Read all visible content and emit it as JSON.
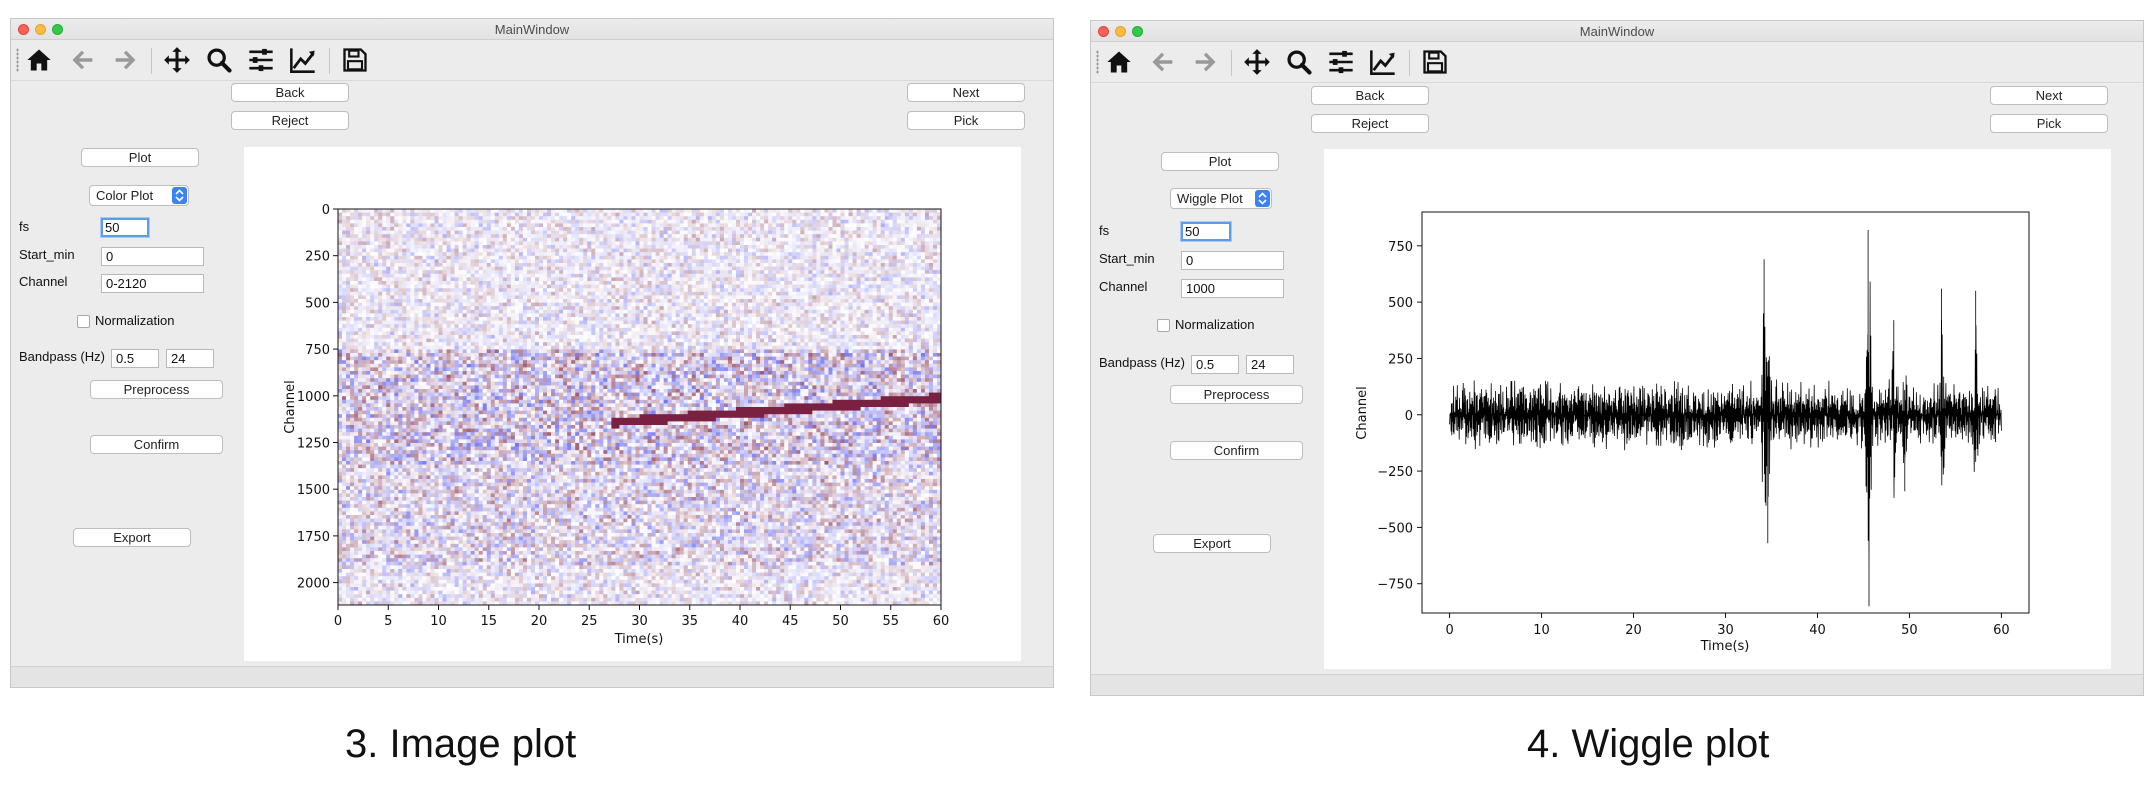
{
  "left_window": {
    "title": "MainWindow",
    "toolbar": [
      "home-icon",
      "back-arrow-icon",
      "forward-arrow-icon",
      "pan-icon",
      "zoom-icon",
      "configure-subplots-icon",
      "edit-axis-icon",
      "save-icon"
    ],
    "buttons": {
      "back": "Back",
      "reject": "Reject",
      "next": "Next",
      "pick": "Pick",
      "plot": "Plot",
      "preprocess": "Preprocess",
      "confirm": "Confirm",
      "export": "Export"
    },
    "plot_type": "Color Plot",
    "fields": {
      "fs_label": "fs",
      "fs_value": "50",
      "start_label": "Start_min",
      "start_value": "0",
      "channel_label": "Channel",
      "channel_value": "0-2120",
      "normalization_label": "Normalization",
      "bandpass_label": "Bandpass (Hz)",
      "bandpass_low": "0.5",
      "bandpass_high": "24"
    },
    "chart_data": {
      "type": "heatmap",
      "xlabel": "Time(s)",
      "ylabel": "Channel",
      "xlim": [
        0,
        60
      ],
      "ylim": [
        2120,
        0
      ],
      "xticks": [
        "0",
        "5",
        "10",
        "15",
        "20",
        "25",
        "30",
        "35",
        "40",
        "45",
        "50",
        "55",
        "60"
      ],
      "yticks": [
        "0",
        "250",
        "500",
        "750",
        "1000",
        "1250",
        "1500",
        "1750",
        "2000"
      ],
      "colormap": "seismic-like (blue-white-red)"
    }
  },
  "right_window": {
    "title": "MainWindow",
    "toolbar": [
      "home-icon",
      "back-arrow-icon",
      "forward-arrow-icon",
      "pan-icon",
      "zoom-icon",
      "configure-subplots-icon",
      "edit-axis-icon",
      "save-icon"
    ],
    "buttons": {
      "back": "Back",
      "reject": "Reject",
      "next": "Next",
      "pick": "Pick",
      "plot": "Plot",
      "preprocess": "Preprocess",
      "confirm": "Confirm",
      "export": "Export"
    },
    "plot_type": "Wiggle Plot",
    "fields": {
      "fs_label": "fs",
      "fs_value": "50",
      "start_label": "Start_min",
      "start_value": "0",
      "channel_label": "Channel",
      "channel_value": "1000",
      "normalization_label": "Normalization",
      "bandpass_label": "Bandpass (Hz)",
      "bandpass_low": "0.5",
      "bandpass_high": "24"
    },
    "chart_data": {
      "type": "line",
      "xlabel": "Time(s)",
      "ylabel": "Channel",
      "xlim": [
        -3,
        63
      ],
      "ylim": [
        -880,
        900
      ],
      "xticks": [
        0,
        10,
        20,
        30,
        40,
        50,
        60
      ],
      "yticks": [
        -750,
        -500,
        -250,
        0,
        250,
        500,
        750
      ],
      "series": [
        {
          "color": "#000000",
          "baseline_amplitude": 120,
          "bursts": [
            {
              "x": 34.2,
              "y": 690
            },
            {
              "x": 34.6,
              "y": -570
            },
            {
              "x": 45.5,
              "y": 820
            },
            {
              "x": 45.6,
              "y": -850
            },
            {
              "x": 53.5,
              "y": 560
            },
            {
              "x": 57.2,
              "y": 550
            },
            {
              "x": 48.3,
              "y": 420
            },
            {
              "x": 49.5,
              "y": -340
            }
          ]
        }
      ]
    }
  },
  "captions": {
    "left": "3. Image plot",
    "right": "4. Wiggle plot"
  }
}
